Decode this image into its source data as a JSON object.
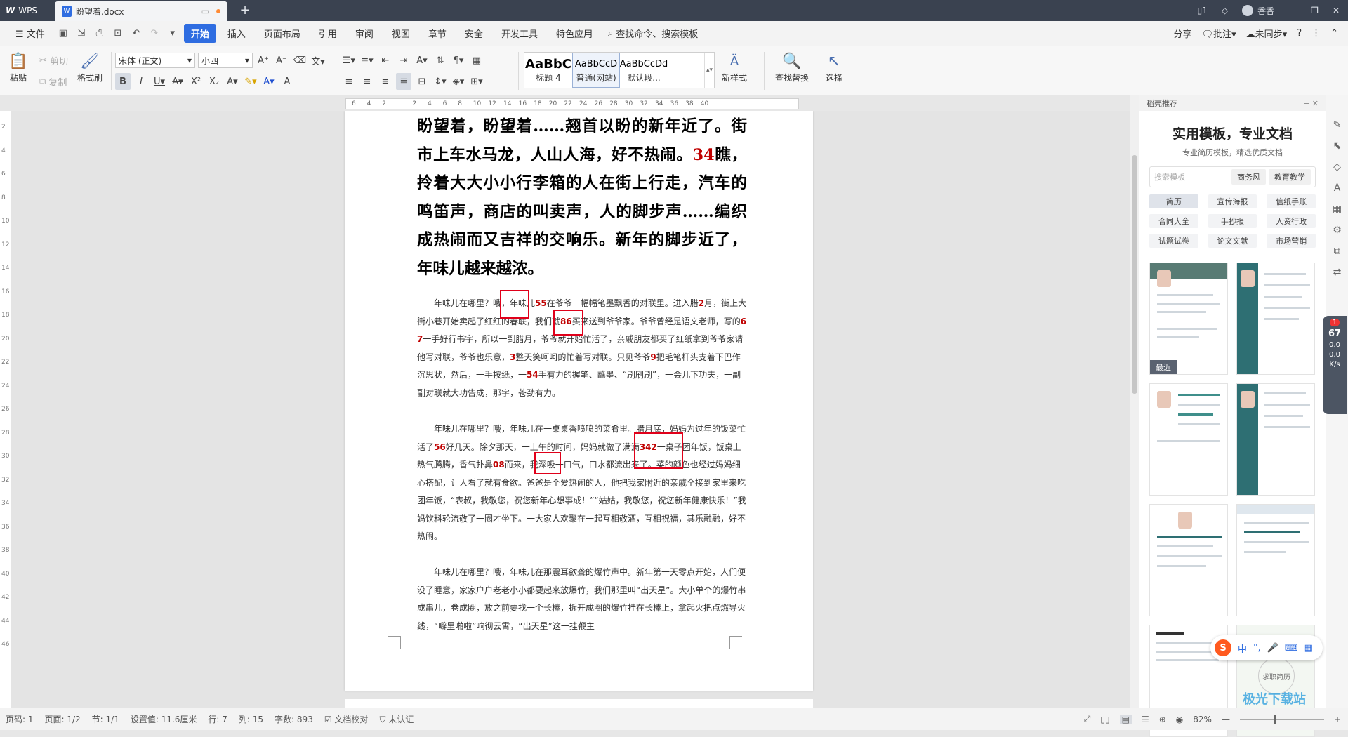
{
  "titlebar": {
    "app_name": "WPS",
    "doc_tab": "盼望着.docx",
    "user": "香香"
  },
  "menubar": {
    "file": "文件",
    "tabs": [
      "开始",
      "插入",
      "页面布局",
      "引用",
      "审阅",
      "视图",
      "章节",
      "安全",
      "开发工具",
      "特色应用"
    ],
    "active_tab": "开始",
    "search": "查找命令、搜索模板",
    "right": {
      "share": "分享",
      "comment": "批注",
      "sync": "未同步"
    }
  },
  "ribbon": {
    "paste": "粘贴",
    "cut": "剪切",
    "copy": "复制",
    "format_painter": "格式刷",
    "font_name": "宋体 (正文)",
    "font_size": "小四",
    "styles": [
      {
        "preview": "AaBbC",
        "name": "标题 4"
      },
      {
        "preview": "AaBbCcD",
        "name": "普通(网站)"
      },
      {
        "preview": "AaBbCcDd",
        "name": "默认段..."
      }
    ],
    "new_style": "新样式",
    "find_replace": "查找替换",
    "select": "选择"
  },
  "ruler": {
    "h_ticks": [
      "6",
      "4",
      "2",
      "",
      "2",
      "4",
      "6",
      "8",
      "10",
      "12",
      "14",
      "16",
      "18",
      "20",
      "22",
      "24",
      "26",
      "28",
      "30",
      "32",
      "34",
      "36",
      "38",
      "40"
    ],
    "v_ticks": [
      "2",
      "4",
      "6",
      "8",
      "10",
      "12",
      "14",
      "16",
      "18",
      "20",
      "22",
      "24",
      "26",
      "28",
      "30",
      "32",
      "34",
      "36",
      "38",
      "40",
      "42",
      "44",
      "46"
    ]
  },
  "document": {
    "big_paragraph": [
      {
        "t": "盼望着，盼望着……翘首以盼的新年近了。街市上车水马龙，人山人海，好不热闹。"
      },
      {
        "t": "34",
        "num": true
      },
      {
        "t": "瞧，拎着大大小小行李箱的人在街上行走，汽车的鸣笛声，商店的叫卖声，人的脚步声……编织成热闹而又吉祥的交响乐。新年的脚步近了，年味儿越来越浓。"
      }
    ],
    "para1": [
      {
        "t": "　　年味儿在哪里？哦，年味儿"
      },
      {
        "t": "55",
        "num": true
      },
      {
        "t": "在爷爷一幅幅笔墨飘香的对联里。进入腊"
      },
      {
        "t": "2",
        "num": true
      },
      {
        "t": "月，街上大街小巷开始卖起了红红的春联，我们就"
      },
      {
        "t": "86",
        "num": true
      },
      {
        "t": "买来送到爷爷家。爷爷曾经是语文老师，写的"
      },
      {
        "t": "67",
        "num": true
      },
      {
        "t": "一手好行书字，所以一到腊月，爷爷就开始忙活了，亲戚朋友都买了红纸拿到爷爷家请他写对联，爷爷也乐意，"
      },
      {
        "t": "3",
        "num": true
      },
      {
        "t": "整天笑呵呵的忙着写对联。只见爷爷"
      },
      {
        "t": "9",
        "num": true
      },
      {
        "t": "把毛笔杆头支着下巴作沉思状，然后，一手按纸，一"
      },
      {
        "t": "54",
        "num": true
      },
      {
        "t": "手有力的握笔、蘸墨、“刷刷刷”，一会儿下功夫，一副副对联就大功告成，那字，苍劲有力。"
      }
    ],
    "para2": [
      {
        "t": "　　年味儿在哪里？哦，年味儿在一桌桌香喷喷的菜肴里。腊月底，妈妈为过年的饭菜忙活了"
      },
      {
        "t": "56",
        "num": true
      },
      {
        "t": "好几天。除夕那天，一上午的时间，妈妈就做了满满"
      },
      {
        "t": "342",
        "num": true
      },
      {
        "t": "一桌子团年饭，饭桌上热气腾腾，香气扑鼻"
      },
      {
        "t": "08",
        "num": true
      },
      {
        "t": "而来，我深吸一口气，口水都流出来了。菜的颜色也经过妈妈细心搭配，让人看了就有食欲。爸爸是个爱热闹的人，他把我家附近的亲戚全接到家里来吃团年饭，“表叔，我敬您，祝您新年心想事成！”“姑姑，我敬您，祝您新年健康快乐！”我妈饮料轮流敬了一圈才坐下。一大家人欢聚在一起互相敬酒，互相祝福，其乐融融，好不热闹。"
      }
    ],
    "para3": [
      {
        "t": "　　年味儿在哪里？哦，年味儿在那震耳欲聋的爆竹声中。新年第一天零点开始，人们便没了睡意，家家户户老老小小都要起来放爆竹，我们那里叫“出天星”。大小单个的爆竹串成串儿，卷成圈，放之前要找一个长棒，拆开成圈的爆竹挂在长棒上，拿起火把点燃导火线，“噼里啪啦”响彻云霄，“出天星”这一挂鞭主"
      }
    ]
  },
  "panel": {
    "head": "稻壳推荐",
    "title": "实用模板，专业文档",
    "subtitle": "专业简历模板，精选优质文档",
    "search_placeholder": "搜索模板",
    "chips": [
      "商务风",
      "教育教学"
    ],
    "tags": [
      "简历",
      "宣传海报",
      "信纸手账",
      "合同大全",
      "手抄报",
      "人资行政",
      "试题试卷",
      "论文文献",
      "市场营销"
    ],
    "recent": "最近",
    "thumb_text": "求职简历"
  },
  "statusbar": {
    "page_num": "页码: 1",
    "pages": "页面: 1/2",
    "section": "节: 1/1",
    "setting": "设置值: 11.6厘米",
    "row": "行: 7",
    "col": "列: 15",
    "words": "字数: 893",
    "proofread": "文档校对",
    "auth": "未认证",
    "zoom": "82%"
  },
  "widget": {
    "badge": "1",
    "pct": "67",
    "rate1": "0.0",
    "rate2": "0.0",
    "unit": "K/s"
  },
  "ime": {
    "mode": "中",
    "punct": "°,"
  },
  "watermark": "极光下载站"
}
